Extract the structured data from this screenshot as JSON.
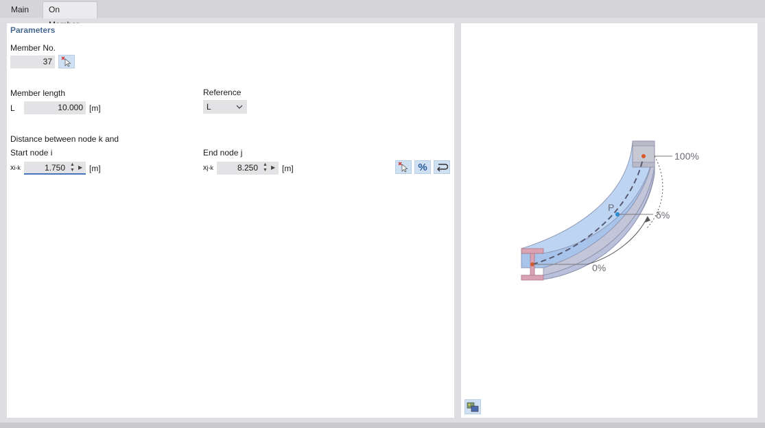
{
  "tabs": [
    {
      "label": "Main",
      "active": false
    },
    {
      "label": "On Member",
      "active": true
    }
  ],
  "parameters": {
    "title": "Parameters",
    "member_no_label": "Member No.",
    "member_no_value": "37",
    "member_length_label": "Member length",
    "length_symbol": "L",
    "length_value": "10.000",
    "unit": "[m]",
    "reference_label": "Reference",
    "reference_value": "L",
    "distance_label": "Distance between node k and",
    "start_node_label": "Start node i",
    "start_symbol_main": "x",
    "start_symbol_sub": "i-k",
    "start_value": "1.750",
    "end_node_label": "End node j",
    "end_symbol_main": "x",
    "end_symbol_sub": "j-k",
    "end_value": "8.250"
  },
  "toolbar": {
    "percent_label": "%"
  },
  "diagram": {
    "label_100": "100%",
    "label_delta": "δ%",
    "label_0": "0%",
    "label_p": "P"
  },
  "colors": {
    "accent": "#4477bb",
    "title": "#4a6a92",
    "beam_flange": "#d9a3b3",
    "point_red": "#d85a2a",
    "point_blue": "#2a8fd8"
  }
}
